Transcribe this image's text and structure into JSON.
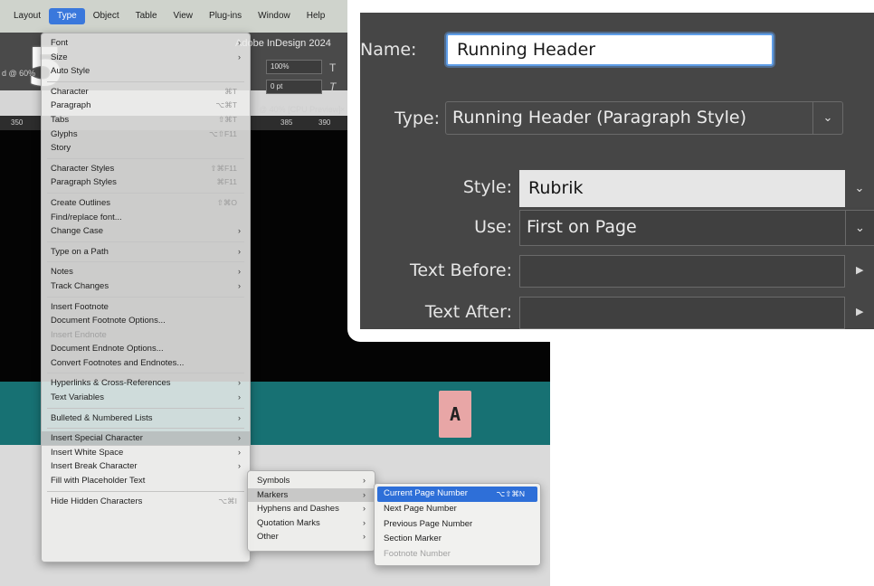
{
  "step_number": "5",
  "menubar": {
    "items": [
      "Layout",
      "Type",
      "Object",
      "Table",
      "View",
      "Plug-ins",
      "Window",
      "Help"
    ],
    "active": "Type"
  },
  "app": {
    "title": "Adobe InDesign 2024",
    "zoom_left": "d @ 60%",
    "zoom_tab": "@ 40% [CPU Preview]",
    "size_field": "100%",
    "tracking_field": "0 pt",
    "ruler": [
      "350",
      "385",
      "390"
    ]
  },
  "badge": "A",
  "type_menu": {
    "groups": [
      [
        {
          "label": "Font",
          "arrow": true
        },
        {
          "label": "Size",
          "arrow": true
        },
        {
          "label": "Auto Style"
        }
      ],
      [
        {
          "label": "Character",
          "shortcut": "⌘T"
        },
        {
          "label": "Paragraph",
          "shortcut": "⌥⌘T"
        },
        {
          "label": "Tabs",
          "shortcut": "⇧⌘T"
        },
        {
          "label": "Glyphs",
          "shortcut": "⌥⇧F11"
        },
        {
          "label": "Story"
        }
      ],
      [
        {
          "label": "Character Styles",
          "shortcut": "⇧⌘F11"
        },
        {
          "label": "Paragraph Styles",
          "shortcut": "⌘F11"
        }
      ],
      [
        {
          "label": "Create Outlines",
          "shortcut": "⇧⌘O"
        },
        {
          "label": "Find/replace font..."
        },
        {
          "label": "Change Case",
          "arrow": true
        }
      ],
      [
        {
          "label": "Type on a Path",
          "arrow": true
        }
      ],
      [
        {
          "label": "Notes",
          "arrow": true
        },
        {
          "label": "Track Changes",
          "arrow": true
        }
      ],
      [
        {
          "label": "Insert Footnote"
        },
        {
          "label": "Document Footnote Options..."
        },
        {
          "label": "Insert Endnote",
          "disabled": true
        },
        {
          "label": "Document Endnote Options..."
        },
        {
          "label": "Convert Footnotes and Endnotes..."
        }
      ],
      [
        {
          "label": "Hyperlinks & Cross-References",
          "arrow": true
        },
        {
          "label": "Text Variables",
          "arrow": true
        }
      ],
      [
        {
          "label": "Bulleted & Numbered Lists",
          "arrow": true
        }
      ],
      [
        {
          "label": "Insert Special Character",
          "arrow": true,
          "highlighted": true
        },
        {
          "label": "Insert White Space",
          "arrow": true
        },
        {
          "label": "Insert Break Character",
          "arrow": true
        },
        {
          "label": "Fill with Placeholder Text"
        }
      ],
      [
        {
          "label": "Hide Hidden Characters",
          "shortcut": "⌥⌘I"
        }
      ]
    ]
  },
  "special_char_submenu": [
    {
      "label": "Symbols",
      "arrow": true
    },
    {
      "label": "Markers",
      "arrow": true,
      "highlighted": true
    },
    {
      "label": "Hyphens and Dashes",
      "arrow": true
    },
    {
      "label": "Quotation Marks",
      "arrow": true
    },
    {
      "label": "Other",
      "arrow": true
    }
  ],
  "markers_submenu": [
    {
      "label": "Current Page Number",
      "shortcut": "⌥⇧⌘N",
      "selected": true
    },
    {
      "label": "Next Page Number"
    },
    {
      "label": "Previous Page Number"
    },
    {
      "label": "Section Marker"
    },
    {
      "label": "Footnote Number",
      "disabled": true
    }
  ],
  "dialog": {
    "name_label": "Name:",
    "name_value": "Running Header",
    "type_label": "Type:",
    "type_value": "Running Header (Paragraph Style)",
    "style_label": "Style:",
    "style_value": "Rubrik",
    "use_label": "Use:",
    "use_value": "First on Page",
    "text_before_label": "Text Before:",
    "text_before_value": "",
    "text_after_label": "Text After:",
    "text_after_value": ""
  },
  "colors": {
    "menu_selection": "#2e6fd8",
    "teal_band": "#177173",
    "badge": "#e8a6a6",
    "dialog_bg": "#464646",
    "focus_ring": "#5f9ee8"
  }
}
